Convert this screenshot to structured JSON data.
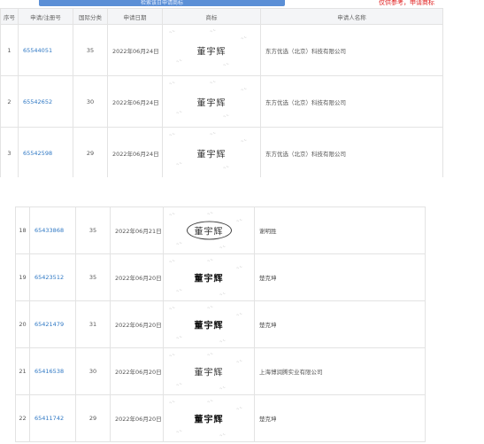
{
  "topbar": {
    "search_button": "检索该日申请商标",
    "notice": "仅供参考，申请商标"
  },
  "columns": [
    "序号",
    "申请/注册号",
    "国际分类",
    "申请日期",
    "商标",
    "申请人名称"
  ],
  "rows_top": [
    {
      "no": "1",
      "reg": "65544051",
      "cls": "35",
      "date": "2022年06月24日",
      "mark": "董宇辉",
      "applicant": "东方优选（北京）科技有限公司"
    },
    {
      "no": "2",
      "reg": "65542652",
      "cls": "30",
      "date": "2022年06月24日",
      "mark": "董宇辉",
      "applicant": "东方优选（北京）科技有限公司"
    },
    {
      "no": "3",
      "reg": "65542598",
      "cls": "29",
      "date": "2022年06月24日",
      "mark": "董宇辉",
      "applicant": "东方优选（北京）科技有限公司"
    }
  ],
  "rows_bottom": [
    {
      "no": "18",
      "reg": "65433868",
      "cls": "35",
      "date": "2022年06月21日",
      "mark": "董宇辉",
      "applicant": "谢明胜",
      "style": "oval"
    },
    {
      "no": "19",
      "reg": "65423512",
      "cls": "35",
      "date": "2022年06月20日",
      "mark": "董宇辉",
      "applicant": "楚克坤",
      "style": "bold"
    },
    {
      "no": "20",
      "reg": "65421479",
      "cls": "31",
      "date": "2022年06月20日",
      "mark": "董宇辉",
      "applicant": "楚克坤",
      "style": "bold"
    },
    {
      "no": "21",
      "reg": "65416538",
      "cls": "30",
      "date": "2022年06月20日",
      "mark": "董宇辉",
      "applicant": "上海博润腾实业有限公司",
      "style": "plain"
    },
    {
      "no": "22",
      "reg": "65411742",
      "cls": "29",
      "date": "2022年06月20日",
      "mark": "董宇辉",
      "applicant": "楚克坤",
      "style": "bold"
    }
  ]
}
